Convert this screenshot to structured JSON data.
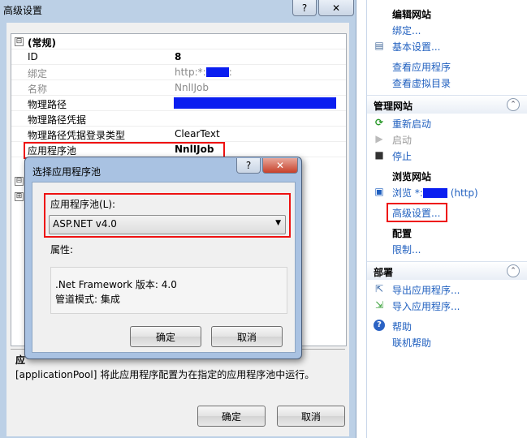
{
  "advanced": {
    "title": "高级设置",
    "help_btn": "?",
    "close_btn": "✕",
    "group1": {
      "toggle": "⊟",
      "label": "(常规)"
    },
    "rows": [
      {
        "name": "ID",
        "value": "8"
      },
      {
        "name": "绑定",
        "value_prefix": "http:*:",
        "value_suffix": ":"
      },
      {
        "name": "名称",
        "value": "NnlIJob"
      },
      {
        "name": "物理路径",
        "value": ""
      },
      {
        "name": "物理路径凭据",
        "value": ""
      },
      {
        "name": "物理路径凭据登录类型",
        "value": "ClearText"
      },
      {
        "name": "应用程序池",
        "value": "NnlIJob"
      }
    ],
    "group2_toggle": "⊟",
    "group3_toggle": "⊞",
    "description": {
      "title": "应",
      "text": "[applicationPool] 将此应用程序配置为在指定的应用程序池中运行。"
    },
    "ok": "确定",
    "cancel": "取消"
  },
  "dialog": {
    "title": "选择应用程序池",
    "help_btn": "?",
    "close_btn": "✕",
    "pool_label": "应用程序池(L):",
    "pool_value": "ASP.NET v4.0",
    "props_label": "属性:",
    "props": [
      ".Net Framework 版本: 4.0",
      "管道模式: 集成"
    ],
    "ok": "确定",
    "cancel": "取消"
  },
  "pane": {
    "edit_site": {
      "title": "编辑网站",
      "links": [
        "绑定...",
        "基本设置...",
        "查看应用程序",
        "查看虚拟目录"
      ]
    },
    "manage_site": {
      "title": "管理网站",
      "restart": "重新启动",
      "start": "启动",
      "stop": "停止",
      "browse_title": "浏览网站",
      "browse_prefix": "浏览 *:",
      "browse_suffix": "(http)",
      "advanced": "高级设置...",
      "config_title": "配置",
      "limits": "限制..."
    },
    "deploy": {
      "title": "部署",
      "export": "导出应用程序...",
      "import": "导入应用程序..."
    },
    "help": {
      "help": "帮助",
      "online": "联机帮助"
    },
    "collapse": "⌃"
  }
}
